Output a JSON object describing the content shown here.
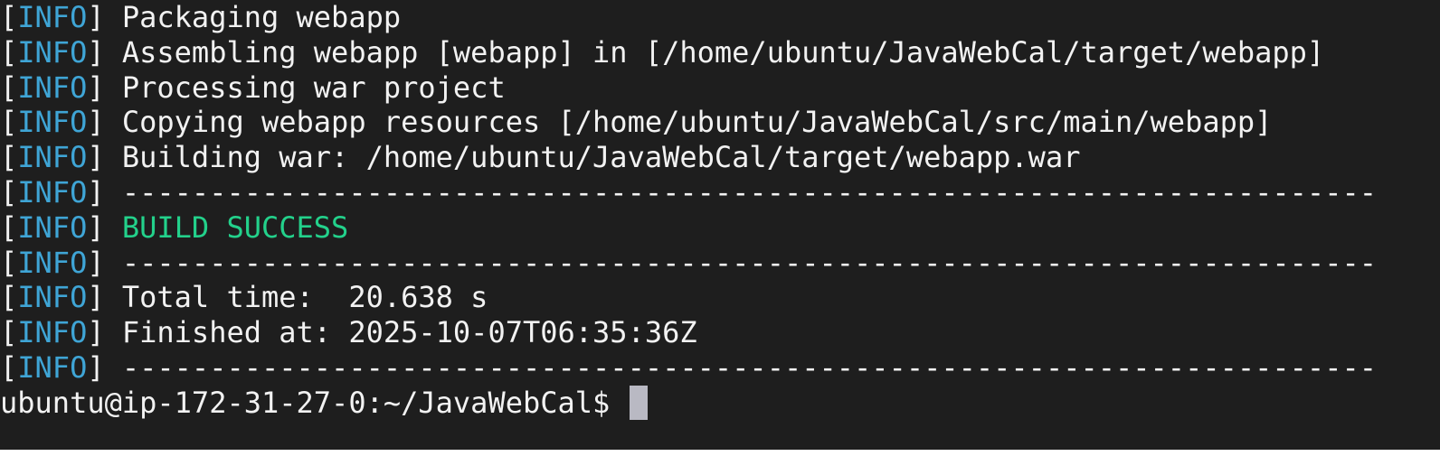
{
  "terminal": {
    "lines": [
      {
        "level": "INFO",
        "text": "Packaging webapp",
        "style": "normal"
      },
      {
        "level": "INFO",
        "text": "Assembling webapp [webapp] in [/home/ubuntu/JavaWebCal/target/webapp]",
        "style": "normal"
      },
      {
        "level": "INFO",
        "text": "Processing war project",
        "style": "normal"
      },
      {
        "level": "INFO",
        "text": "Copying webapp resources [/home/ubuntu/JavaWebCal/src/main/webapp]",
        "style": "normal"
      },
      {
        "level": "INFO",
        "text": "Building war: /home/ubuntu/JavaWebCal/target/webapp.war",
        "style": "normal"
      },
      {
        "level": "INFO",
        "text": "------------------------------------------------------------------------",
        "style": "normal"
      },
      {
        "level": "INFO",
        "text": "BUILD SUCCESS",
        "style": "success"
      },
      {
        "level": "INFO",
        "text": "------------------------------------------------------------------------",
        "style": "normal"
      },
      {
        "level": "INFO",
        "text": "Total time:  20.638 s",
        "style": "normal"
      },
      {
        "level": "INFO",
        "text": "Finished at: 2025-10-07T06:35:36Z",
        "style": "normal"
      },
      {
        "level": "INFO",
        "text": "------------------------------------------------------------------------",
        "style": "normal"
      }
    ],
    "prompt": "ubuntu@ip-172-31-27-0:~/JavaWebCal$ ",
    "colors": {
      "background": "#1e1e1e",
      "foreground": "#f2f2f2",
      "level": "#3fa5d6",
      "success": "#23d18b",
      "cursor": "#b9b9c3"
    }
  }
}
